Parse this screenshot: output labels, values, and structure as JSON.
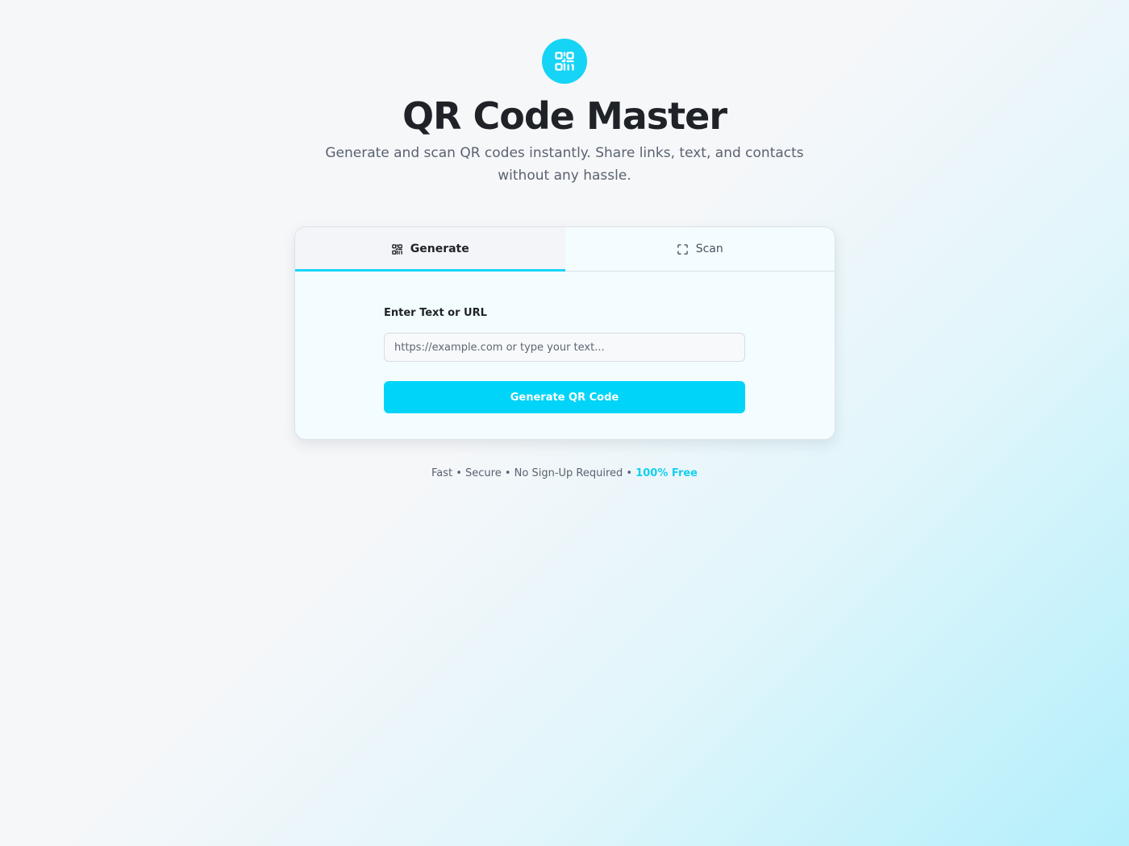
{
  "header": {
    "logo_icon": "qr-code-icon",
    "title": "QR Code Master",
    "subtitle": "Generate and scan QR codes instantly. Share links, text, and contacts without any hassle."
  },
  "tabs": [
    {
      "label": "Generate",
      "icon": "qr-code-icon",
      "active": true
    },
    {
      "label": "Scan",
      "icon": "scan-frame-icon",
      "active": false
    }
  ],
  "generate": {
    "field_label": "Enter Text or URL",
    "input_value": "",
    "input_placeholder": "https://example.com or type your text...",
    "button_label": "Generate QR Code"
  },
  "footer": {
    "text": "Fast • Secure • No Sign-Up Required • ",
    "highlight": "100% Free"
  },
  "colors": {
    "accent": "#16d4f5",
    "button": "#00d4f8",
    "text": "#1f2328",
    "muted": "#5a6270"
  }
}
